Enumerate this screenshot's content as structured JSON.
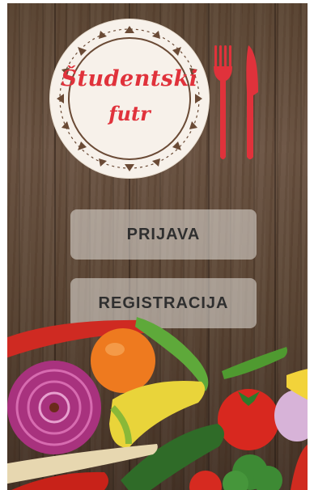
{
  "logo": {
    "line1": "Študentski",
    "line2": "futr"
  },
  "buttons": {
    "login": "PRIJAVA",
    "register": "REGISTRACIJA"
  },
  "colors": {
    "brand_red": "#e0323b",
    "wood": "#5b4634",
    "button_bg": "#e6e1dc"
  },
  "icons": [
    "fork-icon",
    "knife-icon"
  ]
}
